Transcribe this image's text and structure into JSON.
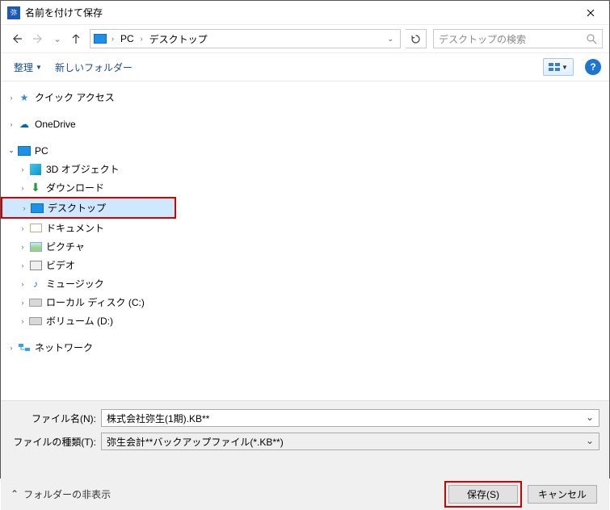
{
  "title": "名前を付けて保存",
  "breadcrumb": {
    "root": "PC",
    "folder": "デスクトップ"
  },
  "search_placeholder": "デスクトップの検索",
  "toolbar": {
    "organize": "整理",
    "new_folder": "新しいフォルダー"
  },
  "tree": {
    "quick_access": "クイック アクセス",
    "onedrive": "OneDrive",
    "pc": "PC",
    "objects3d": "3D オブジェクト",
    "downloads": "ダウンロード",
    "desktop": "デスクトップ",
    "documents": "ドキュメント",
    "pictures": "ピクチャ",
    "videos": "ビデオ",
    "music": "ミュージック",
    "localdisk": "ローカル ディスク (C:)",
    "volume": "ボリューム (D:)",
    "network": "ネットワーク"
  },
  "form": {
    "filename_label": "ファイル名(N):",
    "filename_value": "株式会社弥生(1期).KB**",
    "filetype_label": "ファイルの種類(T):",
    "filetype_value": "弥生会計**バックアップファイル(*.KB**)"
  },
  "footer": {
    "hide_folders": "フォルダーの非表示",
    "save": "保存(S)",
    "cancel": "キャンセル"
  }
}
